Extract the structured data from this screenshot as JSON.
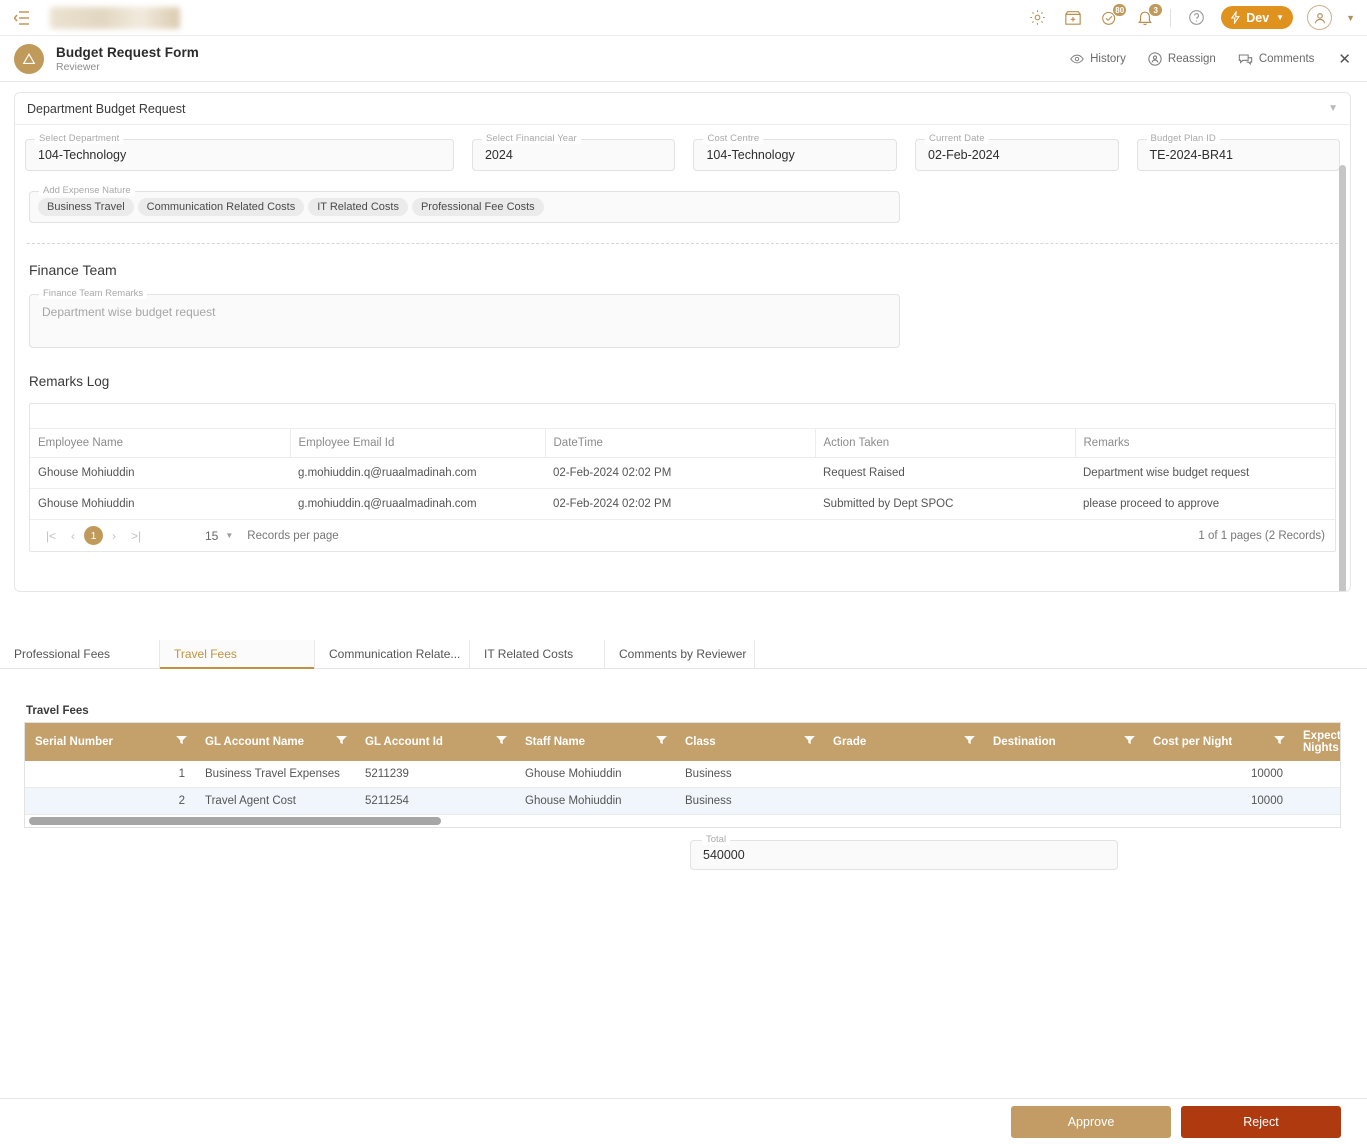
{
  "topbar": {
    "menu_icon": "hamburger-icon",
    "logo": "company-logo",
    "icons": [
      {
        "name": "gear-icon",
        "badge": null
      },
      {
        "name": "store-icon",
        "badge": null
      },
      {
        "name": "tasks-check-icon",
        "badge": "80"
      },
      {
        "name": "bell-icon",
        "badge": "3"
      },
      {
        "name": "help-icon",
        "badge": null
      }
    ],
    "env_button": "Dev",
    "badge_tasks": "80",
    "badge_bell": "3"
  },
  "form_header": {
    "title": "Budget Request Form",
    "subtitle": "Reviewer",
    "actions": [
      {
        "label": "History",
        "icon": "eye-icon"
      },
      {
        "label": "Reassign",
        "icon": "user-circle-icon"
      },
      {
        "label": "Comments",
        "icon": "comment-icon"
      }
    ],
    "close": "✕"
  },
  "section": {
    "title": "Department Budget Request",
    "fields": [
      {
        "label": "Select Department",
        "value": "104-Technology"
      },
      {
        "label": "Select Financial Year",
        "value": "2024"
      },
      {
        "label": "Cost Centre",
        "value": "104-Technology"
      },
      {
        "label": "Current Date",
        "value": "02-Feb-2024"
      },
      {
        "label": "Budget Plan ID",
        "value": "TE-2024-BR41"
      }
    ],
    "expense_nature": {
      "label": "Add Expense Nature",
      "chips": [
        "Business Travel",
        "Communication Related Costs",
        "IT Related Costs",
        "Professional Fee Costs"
      ]
    }
  },
  "finance_team": {
    "title": "Finance Team",
    "remarks_label": "Finance Team Remarks",
    "remarks_value": "Department wise budget request"
  },
  "remarks_log": {
    "title": "Remarks Log",
    "columns": [
      "Employee Name",
      "Employee Email Id",
      "DateTime",
      "Action Taken",
      "Remarks"
    ],
    "rows": [
      {
        "employee_name": "Ghouse Mohiuddin",
        "employee_email": "g.mohiuddin.q@ruaalmadinah.com",
        "datetime": "02-Feb-2024 02:02 PM",
        "action_taken": "Request Raised",
        "remarks": "Department wise budget request"
      },
      {
        "employee_name": "Ghouse Mohiuddin",
        "employee_email": "g.mohiuddin.q@ruaalmadinah.com",
        "datetime": "02-Feb-2024 02:02 PM",
        "action_taken": "Submitted by Dept SPOC",
        "remarks": "please proceed to approve"
      }
    ],
    "pager": {
      "first": "|<",
      "prev": "‹",
      "current_page": "1",
      "next": "›",
      "last": ">|",
      "page_size": "15",
      "page_size_label": "Records per page",
      "summary": "1 of 1 pages (2 Records)"
    }
  },
  "tabs": [
    {
      "label": "Professional Fees",
      "active": false
    },
    {
      "label": "Travel Fees",
      "active": true
    },
    {
      "label": "Communication Relate...",
      "active": false
    },
    {
      "label": "IT Related Costs",
      "active": false
    },
    {
      "label": "Comments by Reviewer",
      "active": false
    }
  ],
  "travel_fees": {
    "title": "Travel Fees",
    "columns": [
      "Serial Number",
      "GL Account Name",
      "GL Account Id",
      "Staff Name",
      "Class",
      "Grade",
      "Destination",
      "Cost per Night",
      "Expected Nights"
    ],
    "rows": [
      {
        "serial": "1",
        "gl_account_name": "Business Travel Expenses",
        "gl_account_id": "5211239",
        "staff_name": "Ghouse Mohiuddin",
        "class": "Business",
        "grade": "",
        "destination": "",
        "cost_per_night": "10000",
        "expected_nights": ""
      },
      {
        "serial": "2",
        "gl_account_name": "Travel Agent Cost",
        "gl_account_id": "5211254",
        "staff_name": "Ghouse Mohiuddin",
        "class": "Business",
        "grade": "",
        "destination": "",
        "cost_per_night": "10000",
        "expected_nights": ""
      }
    ]
  },
  "total": {
    "label": "Total",
    "value": "540000"
  },
  "footer": {
    "approve": "Approve",
    "reject": "Reject"
  },
  "colors": {
    "accent_gold": "#c09a5b",
    "table_header_gold": "#c4a06a",
    "dev_orange": "#e0921e",
    "reject_red": "#b03a10",
    "tab_active": "#c0923f"
  }
}
